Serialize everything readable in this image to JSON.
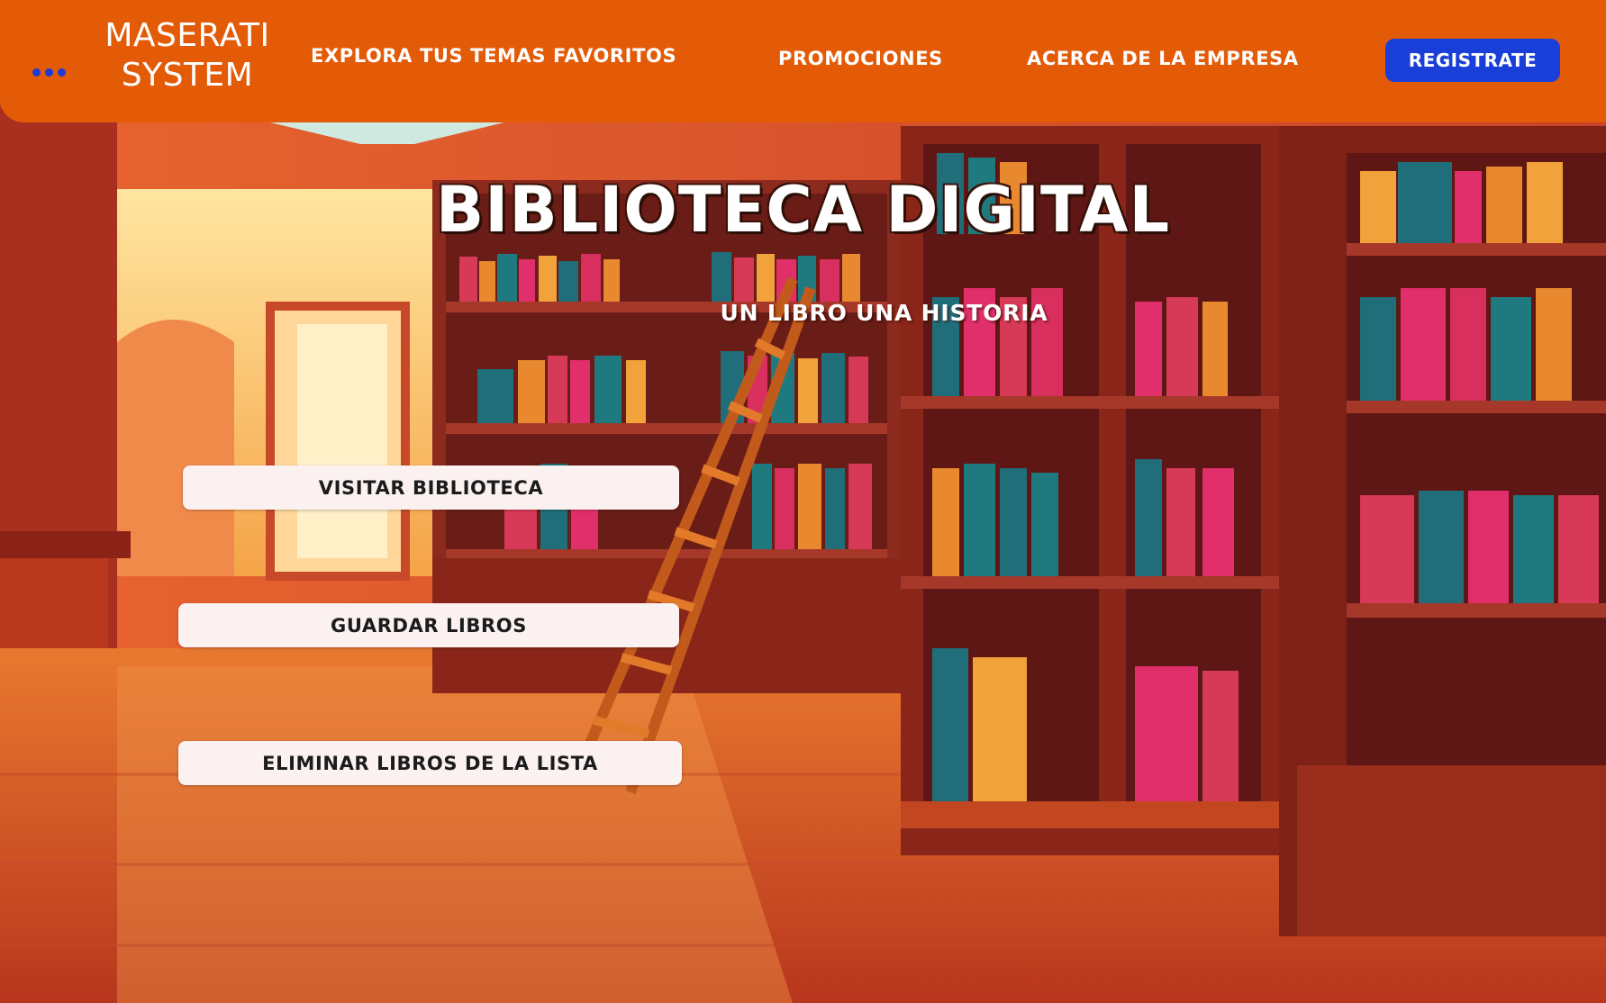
{
  "brand": {
    "line1": "MASERATI",
    "line2": "SYSTEM"
  },
  "header": {
    "menu_icon": "more-dots-icon",
    "nav": [
      {
        "label": "EXPLORA TUS TEMAS FAVORITOS"
      },
      {
        "label": "PROMOCIONES"
      },
      {
        "label": "ACERCA DE LA EMPRESA"
      }
    ],
    "register_label": "REGISTRATE"
  },
  "hero": {
    "title": "BIBLIOTECA DIGITAL",
    "subtitle": "UN LIBRO UNA HISTORIA"
  },
  "actions": [
    {
      "label": "VISITAR BIBLIOTECA"
    },
    {
      "label": "GUARDAR LIBROS"
    },
    {
      "label": "ELIMINAR LIBROS DE LA LISTA"
    }
  ],
  "colors": {
    "header_bg": "#e35a07",
    "accent_blue": "#1a3fd9",
    "button_bg": "#fbf1f1"
  }
}
